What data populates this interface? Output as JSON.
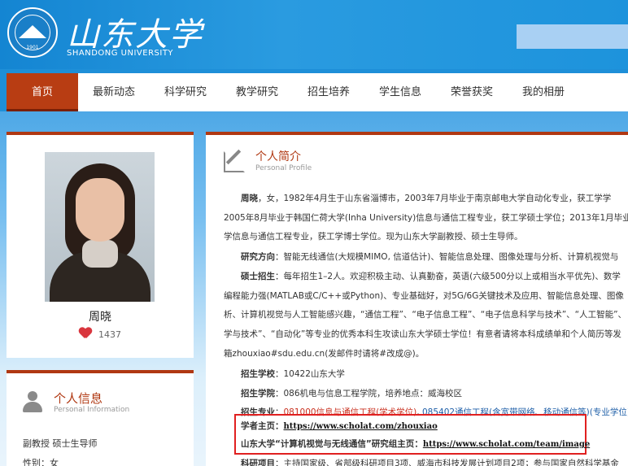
{
  "header": {
    "logo_cn": "山东大学",
    "logo_en": "SHANDONG UNIVERSITY",
    "seal_year": "1901"
  },
  "nav": {
    "items": [
      "首页",
      "最新动态",
      "科学研究",
      "教学研究",
      "招生培养",
      "学生信息",
      "荣誉获奖",
      "我的相册"
    ],
    "active_index": 0
  },
  "profile": {
    "name": "周晓",
    "likes": "1437"
  },
  "info": {
    "title": "个人信息",
    "subtitle": "Personal Information",
    "line1": "副教授 硕士生导师",
    "line2": "性别：女"
  },
  "intro": {
    "title": "个人简介",
    "subtitle": "Personal Profile",
    "p1_name": "周晓",
    "p1_line1": "，女，1982年4月生于山东省淄博市，2003年7月毕业于南京邮电大学自动化专业，获工学学",
    "p1_line2": "2005年8月毕业于韩国仁荷大学(Inha University)信息与通信工程专业，获工学硕士学位；2013年1月毕业",
    "p1_line3": "学信息与通信工程专业，获工学博士学位。现为山东大学副教授、硕士生导师。",
    "research_label": "研究方向",
    "research_text": "：智能无线通信(大规模MIMO, 信道估计)、智能信息处理、图像处理与分析、计算机视觉与",
    "recruit_label": "硕士招生",
    "recruit_line1": "：每年招生1–2人。欢迎积极主动、认真勤奋，英语(六级500分以上或相当水平优先)、数学",
    "recruit_line2": "编程能力强(MATLAB或C/C++或Python)、专业基础好，对5G/6G关键技术及应用、智能信息处理、图像",
    "recruit_line3": "析、计算机视觉与人工智能感兴趣，“通信工程”、“电子信息工程”、“电子信息科学与技术”、“人工智能”、",
    "recruit_line4": "学与技术”、“自动化”等专业的优秀本科生攻读山东大学硕士学位！有意者请将本科成绩单和个人简历等发",
    "recruit_line5": "箱zhouxiao#sdu.edu.cn(发邮件时请将#改成@)。",
    "school_label": "招生学校",
    "school_text": "：10422山东大学",
    "college_label": "招生学院",
    "college_text": "：086机电与信息工程学院，培养地点：威海校区",
    "major_label": "招生专业",
    "major_red": "081000信息与通信工程(学术学位)",
    "major_sep": ", ",
    "major_blue": "085402通信工程(含宽带网络、移动通信等)(专业学位)",
    "scholar_label": "学者主页",
    "scholar_url": "https://www.scholat.com/zhouxiao",
    "group_label": "山东大学“计算机视觉与无线通信”研究组主页",
    "group_url": "https://www.scholat.com/team/image",
    "project_label": "科研项目",
    "project_text": "：主持国家级、省部级科研项目3项、威海市科技发展计划项目2项；参与国家自然科学基金"
  }
}
